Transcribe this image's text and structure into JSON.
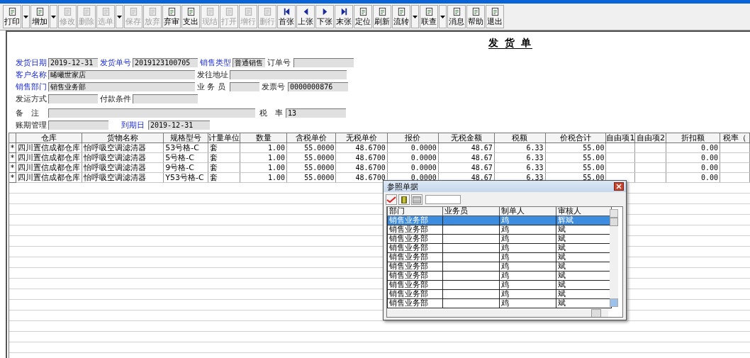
{
  "toolbar": [
    {
      "label": "打印",
      "disabled": false,
      "dropdown": true
    },
    {
      "label": "增加",
      "disabled": false,
      "dropdown": true
    },
    {
      "label": "修改",
      "disabled": true,
      "dropdown": false
    },
    {
      "label": "删除",
      "disabled": true,
      "dropdown": false
    },
    {
      "label": "选单",
      "disabled": true,
      "dropdown": true
    },
    {
      "label": "保存",
      "disabled": true,
      "dropdown": false
    },
    {
      "label": "放弃",
      "disabled": true,
      "dropdown": false
    },
    {
      "label": "弃审",
      "disabled": false,
      "dropdown": false
    },
    {
      "label": "支出",
      "disabled": false,
      "dropdown": false
    },
    {
      "label": "现结",
      "disabled": true,
      "dropdown": false
    },
    {
      "label": "打开",
      "disabled": true,
      "dropdown": false
    },
    {
      "label": "增行",
      "disabled": true,
      "dropdown": false
    },
    {
      "label": "删行",
      "disabled": true,
      "dropdown": false
    },
    {
      "label": "首张",
      "disabled": false,
      "dropdown": false
    },
    {
      "label": "上张",
      "disabled": false,
      "dropdown": false
    },
    {
      "label": "下张",
      "disabled": false,
      "dropdown": false
    },
    {
      "label": "末张",
      "disabled": false,
      "dropdown": false
    },
    {
      "label": "定位",
      "disabled": false,
      "dropdown": false
    },
    {
      "label": "刷新",
      "disabled": false,
      "dropdown": false
    },
    {
      "label": "流转",
      "disabled": false,
      "dropdown": true
    },
    {
      "label": "联查",
      "disabled": false,
      "dropdown": true
    },
    {
      "label": "消息",
      "disabled": false,
      "dropdown": false
    },
    {
      "label": "帮助",
      "disabled": false,
      "dropdown": false
    },
    {
      "label": "退出",
      "disabled": false,
      "dropdown": false
    }
  ],
  "form": {
    "title": "发 货 单",
    "rows": [
      [
        {
          "label": "发货日期",
          "required": true,
          "value": "2019-12-31"
        },
        {
          "label": "发货单号",
          "required": true,
          "value": "2019123100705"
        },
        {
          "label": "销售类型",
          "required": true,
          "value": "普通销售"
        },
        {
          "label": "订单号",
          "required": false
        }
      ],
      [
        {
          "label": "客户名称",
          "required": true,
          "value": "晞曦世家店"
        },
        "",
        {
          "label": "发往地址",
          "required": false
        }
      ],
      [
        {
          "label": "销售部门",
          "required": true,
          "value": "销售业务部"
        },
        "",
        {
          "label": "业 务 员",
          "required": false
        },
        {
          "label": "发票号",
          "required": false,
          "value": "0000000876"
        }
      ],
      [
        {
          "label": "发运方式",
          "required": false
        },
        {
          "label": "付款条件",
          "required": false
        }
      ],
      [
        {
          "label": "备　注",
          "required": false
        },
        "",
        "",
        {
          "label": "税　率",
          "required": false,
          "value": "13"
        }
      ],
      [
        {
          "label": "账期管理",
          "required": false
        },
        {
          "label": "到期日",
          "required": true,
          "value": "2019-12-31"
        }
      ]
    ]
  },
  "table": {
    "columns": [
      "仓库",
      "货物名称",
      "规格型号",
      "计量单位",
      "数量",
      "含税单价",
      "无税单价",
      "报价",
      "无税金额",
      "税额",
      "价税合计",
      "自由项1",
      "自由项2",
      "折扣额",
      "税率（"
    ],
    "rows": [
      {
        "mark": "*",
        "cells": [
          "四川置信成都仓库",
          "怡呼吸空调滤清器",
          "53号格-C",
          "套",
          "1.00",
          "55.0000",
          "48.6700",
          "0.0000",
          "48.67",
          "6.33",
          "55.00",
          "",
          "",
          "0.00",
          ""
        ]
      },
      {
        "mark": "*",
        "cells": [
          "四川置信成都仓库",
          "怡呼吸空调滤清器",
          "5号格-C",
          "套",
          "1.00",
          "55.0000",
          "48.6700",
          "0.0000",
          "48.67",
          "6.33",
          "55.00",
          "",
          "",
          "0.00",
          ""
        ]
      },
      {
        "mark": "*",
        "cells": [
          "四川置信成都仓库",
          "怡呼吸空调滤清器",
          "9号格-C",
          "套",
          "1.00",
          "55.0000",
          "48.6700",
          "0.0000",
          "48.67",
          "6.33",
          "55.00",
          "",
          "",
          "0.00",
          ""
        ]
      },
      {
        "mark": "*",
        "cells": [
          "四川置信成都仓库",
          "怡呼吸空调滤清器",
          "Y53号格-C",
          "套",
          "1.00",
          "55.0000",
          "48.6700",
          "0.0000",
          "48.67",
          "6.33",
          "55.00",
          "",
          "",
          "0.00",
          ""
        ]
      }
    ]
  },
  "dialog": {
    "title": "参照单据",
    "columns": [
      "部门",
      "业务员",
      "制单人",
      "审核人"
    ],
    "rows": [
      {
        "selected": true,
        "cells": [
          "销售业务部",
          "",
          "鸡",
          "辉斌"
        ]
      },
      {
        "selected": false,
        "cells": [
          "销售业务部",
          "",
          "鸡",
          "斌"
        ]
      },
      {
        "selected": false,
        "cells": [
          "销售业务部",
          "",
          "鸡",
          "斌"
        ]
      },
      {
        "selected": false,
        "cells": [
          "销售业务部",
          "",
          "鸡",
          "斌"
        ]
      },
      {
        "selected": false,
        "cells": [
          "销售业务部",
          "",
          "鸡",
          "斌"
        ]
      },
      {
        "selected": false,
        "cells": [
          "销售业务部",
          "",
          "鸡",
          "斌"
        ]
      },
      {
        "selected": false,
        "cells": [
          "销售业务部",
          "",
          "鸡",
          "斌"
        ]
      },
      {
        "selected": false,
        "cells": [
          "销售业务部",
          "",
          "鸡",
          "斌"
        ]
      },
      {
        "selected": false,
        "cells": [
          "销售业务部",
          "",
          "鸡",
          "斌"
        ]
      },
      {
        "selected": false,
        "cells": [
          "销售业务部",
          "",
          "鸡",
          "斌"
        ]
      }
    ]
  }
}
